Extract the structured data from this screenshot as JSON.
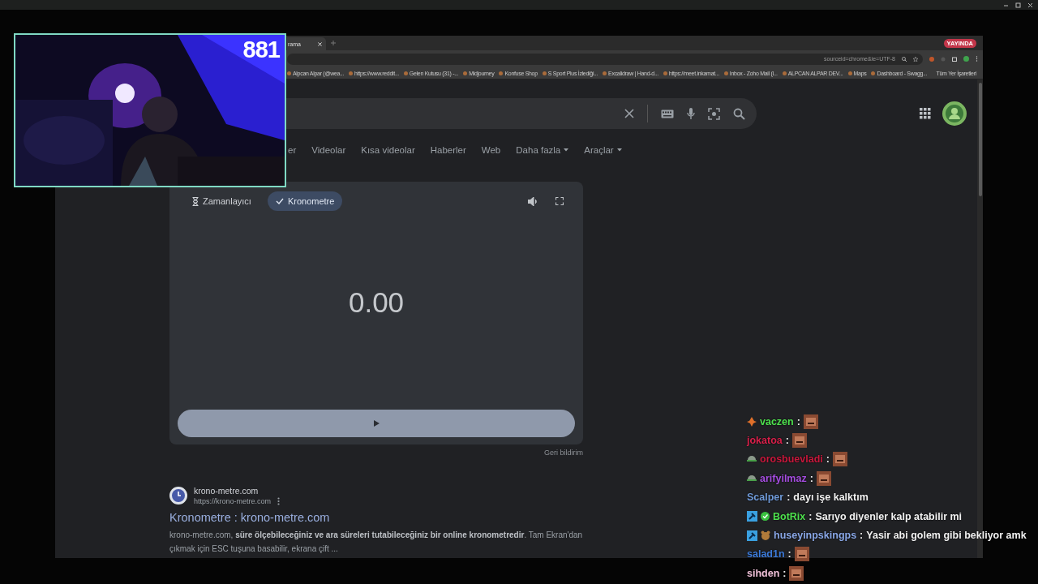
{
  "browser": {
    "tab": {
      "title": "rama"
    },
    "live_badge": "YAYINDA",
    "address": "sourceid=chrome&ie=UTF-8",
    "bookmarks": [
      "Alpcan Alpar (@wea...",
      "https://www.reddit...",
      "Gelen Kutusu (31) -...",
      "Midjourney",
      "Konfuse Shop",
      "S Sport Plus İzlediği...",
      "Excalidraw | Hand-d...",
      "https://meet.inkamat...",
      "Inbox - Zoho Mail (l...",
      "ALPCAN ALPAR DEV...",
      "Maps",
      "Dashboard - Swagg..."
    ],
    "all_bookmarks": "Tüm Yer İşaretleri"
  },
  "search_tabs": [
    {
      "label": "er",
      "kind": "link",
      "selected": false
    },
    {
      "label": "Videolar",
      "kind": "link",
      "selected": false
    },
    {
      "label": "Kısa videolar",
      "kind": "link",
      "selected": false
    },
    {
      "label": "Haberler",
      "kind": "link",
      "selected": false
    },
    {
      "label": "Web",
      "kind": "link",
      "selected": false
    },
    {
      "label": "Daha fazla",
      "kind": "menu",
      "selected": false
    },
    {
      "label": "Araçlar",
      "kind": "menu",
      "selected": false
    }
  ],
  "stopwatch": {
    "modes": [
      {
        "label": "Zamanlayıcı",
        "kind": "timer",
        "selected": false
      },
      {
        "label": "Kronometre",
        "selected": true
      }
    ],
    "reading": "0.00",
    "feedback": "Geri bildirim"
  },
  "result": {
    "site": "krono-metre.com",
    "url": "https://krono-metre.com",
    "title": "Kronometre : krono-metre.com",
    "snippet": "krono-metre.com, **süre ölçebileceğiniz ve ara süreleri tutabileceğiniz bir online kronometredir**. Tam Ekran'dan çıkmak için ESC tuşuna basabilir, ekrana çift ..."
  },
  "webcam": {
    "counter": "881"
  },
  "chat": {
    "messages": [
      {
        "user": "vaczen",
        "color": "#4ee04e",
        "badges": [
          {
            "kind": "flame"
          }
        ],
        "colon": ":",
        "emote": true
      },
      {
        "user": "jokatoa",
        "color": "#d8204a",
        "colon": ":",
        "emote": true
      },
      {
        "user": "orosbuevladi",
        "color": "#c8183c",
        "badges": [
          {
            "kind": "helmet"
          }
        ],
        "colon": ":",
        "emote": true
      },
      {
        "user": "arifyilmaz",
        "color": "#a54de0",
        "badges": [
          {
            "kind": "helmet"
          }
        ],
        "colon": ":",
        "emote": true
      },
      {
        "user": "Scalper",
        "color": "#6f9ad8",
        "colon": ":",
        "text": "dayı işe kalktım"
      },
      {
        "user": "BotRix",
        "color": "#4ee04e",
        "badges": [
          {
            "kind": "mod"
          },
          {
            "kind": "verified"
          }
        ],
        "colon": ":",
        "text": "Sarıyo diyenler kalp atabilir mi"
      },
      {
        "user": "huseyinpskingps",
        "color": "#8aa8e8",
        "badges": [
          {
            "kind": "mod"
          },
          {
            "kind": "bear"
          }
        ],
        "colon": ":",
        "text": "Yasir abi golem gibi bekliyor amk"
      },
      {
        "user": "salad1n",
        "color": "#3c7ad8",
        "colon": ":",
        "emote": true
      },
      {
        "user": "sihden",
        "color": "#f0c0d8",
        "colon": ":",
        "emote": true
      }
    ]
  }
}
